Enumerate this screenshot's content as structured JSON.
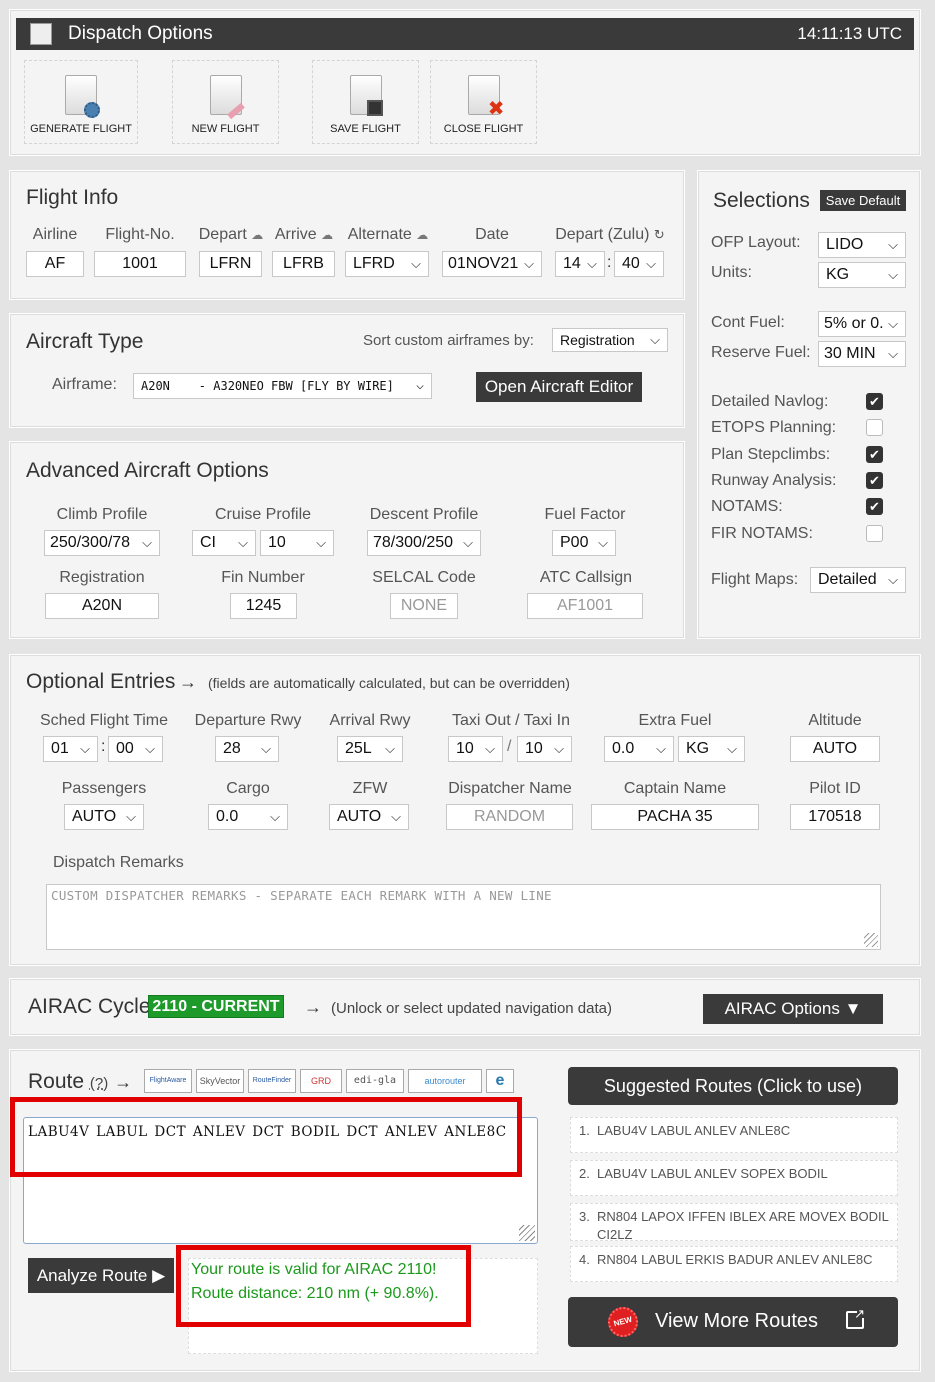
{
  "header": {
    "title": "Dispatch Options",
    "clock": "14:11:13 UTC"
  },
  "toolbar": {
    "generate": "GENERATE FLIGHT",
    "new": "NEW FLIGHT",
    "save": "SAVE FLIGHT",
    "close": "CLOSE FLIGHT"
  },
  "flight_info": {
    "title": "Flight Info",
    "airline_label": "Airline",
    "airline": "AF",
    "flightno_label": "Flight-No.",
    "flightno": "1001",
    "depart_label": "Depart",
    "depart": "LFRN",
    "arrive_label": "Arrive",
    "arrive": "LFRB",
    "alternate_label": "Alternate",
    "alternate": "LFRD",
    "date_label": "Date",
    "date": "01NOV21",
    "depart_zulu_label": "Depart (Zulu)",
    "depart_hour": "14",
    "depart_min": "40"
  },
  "aircraft_type": {
    "title": "Aircraft Type",
    "sort_label": "Sort custom airframes by:",
    "sort_value": "Registration",
    "airframe_label": "Airframe:",
    "airframe_value": "A20N    - A320NEO FBW [FLY BY WIRE]",
    "editor_button": "Open Aircraft Editor"
  },
  "advanced": {
    "title": "Advanced Aircraft Options",
    "climb_label": "Climb Profile",
    "climb": "250/300/78",
    "cruise_label": "Cruise Profile",
    "cruise_mode": "CI",
    "cruise_value": "10",
    "descent_label": "Descent Profile",
    "descent": "78/300/250",
    "fuel_factor_label": "Fuel Factor",
    "fuel_factor": "P00",
    "registration_label": "Registration",
    "registration": "A20N",
    "fin_label": "Fin Number",
    "fin": "1245",
    "selcal_label": "SELCAL Code",
    "selcal": "NONE",
    "atc_label": "ATC Callsign",
    "atc": "AF1001"
  },
  "selections": {
    "title": "Selections",
    "save_default": "Save Default",
    "ofp_label": "OFP Layout:",
    "ofp": "LIDO",
    "units_label": "Units:",
    "units": "KG",
    "cont_fuel_label": "Cont Fuel:",
    "cont_fuel": "5% or 0.",
    "reserve_label": "Reserve Fuel:",
    "reserve": "30 MIN",
    "checks": [
      {
        "label": "Detailed Navlog:",
        "checked": true
      },
      {
        "label": "ETOPS Planning:",
        "checked": false
      },
      {
        "label": "Plan Stepclimbs:",
        "checked": true
      },
      {
        "label": "Runway Analysis:",
        "checked": true
      },
      {
        "label": "NOTAMS:",
        "checked": true
      },
      {
        "label": "FIR NOTAMS:",
        "checked": false
      }
    ],
    "maps_label": "Flight Maps:",
    "maps": "Detailed"
  },
  "optional": {
    "title": "Optional Entries",
    "arrow": "→",
    "note": "(fields are automatically calculated, but can be overridden)",
    "sched_label": "Sched Flight Time",
    "sched_h": "01",
    "sched_m": "00",
    "dep_rwy_label": "Departure Rwy",
    "dep_rwy": "28",
    "arr_rwy_label": "Arrival Rwy",
    "arr_rwy": "25L",
    "taxi_label": "Taxi Out / Taxi In",
    "taxi_out": "10",
    "taxi_sep": "/",
    "taxi_in": "10",
    "extra_label": "Extra Fuel",
    "extra": "0.0",
    "extra_unit": "KG",
    "alt_label": "Altitude",
    "alt": "AUTO",
    "pax_label": "Passengers",
    "pax": "AUTO",
    "cargo_label": "Cargo",
    "cargo": "0.0",
    "zfw_label": "ZFW",
    "zfw": "AUTO",
    "disp_label": "Dispatcher Name",
    "disp": "RANDOM",
    "capt_label": "Captain Name",
    "capt": "PACHA 35",
    "pilot_label": "Pilot ID",
    "pilot": "170518",
    "remarks_label": "Dispatch Remarks",
    "remarks_placeholder": "CUSTOM DISPATCHER REMARKS - SEPARATE EACH REMARK WITH A NEW LINE"
  },
  "airac": {
    "title": "AIRAC Cycle",
    "badge": "2110 - CURRENT",
    "arrow": "→",
    "note": "(Unlock or select updated navigation data)",
    "button": "AIRAC Options ▼"
  },
  "route": {
    "title": "Route",
    "help": "(?)",
    "arrow": "→",
    "logos": [
      "FlightAware",
      "SkyVector",
      "RouteFinder",
      "GRD",
      "edi-gla",
      "autorouter",
      "e"
    ],
    "text": "LABU4V LABUL DCT ANLEV DCT BODIL DCT ANLEV ANLE8C",
    "analyze_button": "Analyze Route ▶",
    "valid_msg": "Your route is valid for AIRAC 2110!",
    "distance_msg": "Route distance: 210 nm (+ 90.8%)."
  },
  "suggested": {
    "title": "Suggested Routes (Click to use)",
    "items": [
      {
        "n": "1.",
        "text": "LABU4V LABUL ANLEV ANLE8C"
      },
      {
        "n": "2.",
        "text": "LABU4V LABUL ANLEV SOPEX BODIL"
      },
      {
        "n": "3.",
        "text": "RN804 LAPOX IFFEN IBLEX ARE MOVEX BODIL CI2LZ"
      },
      {
        "n": "4.",
        "text": "RN804 LABUL ERKIS BADUR ANLEV ANLE8C"
      }
    ],
    "new_badge": "NEW",
    "more_button": "View More Routes"
  },
  "colors": {
    "header_bg": "#3a3a3a",
    "accent_green": "#1d9a2a",
    "highlight_red": "#e00000",
    "valid_green": "#1a9a1a"
  }
}
